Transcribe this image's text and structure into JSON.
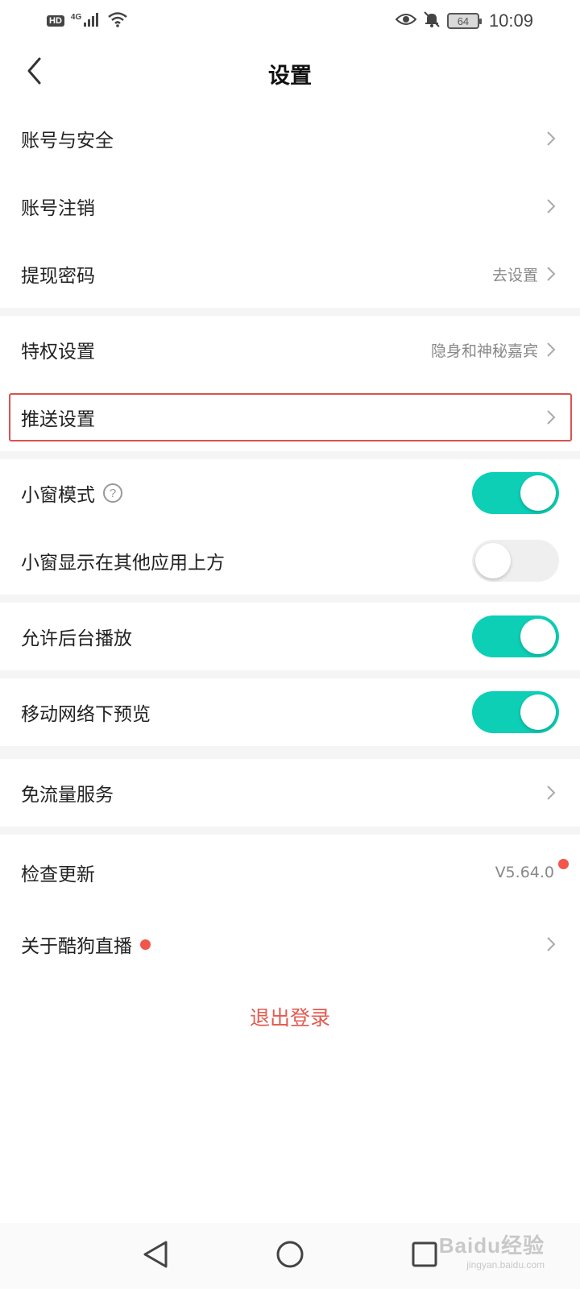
{
  "status_bar": {
    "hd": "HD",
    "network": "4G",
    "battery": "64",
    "time": "10:09",
    "icons": [
      "signal-icon",
      "wifi-icon",
      "eye-icon",
      "bell-off-icon"
    ]
  },
  "header": {
    "title": "设置",
    "back_icon": "chevron-left-icon"
  },
  "settings": {
    "account_security": {
      "label": "账号与安全"
    },
    "account_cancel": {
      "label": "账号注销"
    },
    "withdraw_password": {
      "label": "提现密码",
      "value": "去设置"
    },
    "privilege": {
      "label": "特权设置",
      "value": "隐身和神秘嘉宾"
    },
    "push": {
      "label": "推送设置"
    },
    "mini_window": {
      "label": "小窗模式",
      "help": "?",
      "on": true
    },
    "mini_window_overlay": {
      "label": "小窗显示在其他应用上方",
      "on": false
    },
    "background_play": {
      "label": "允许后台播放",
      "on": true
    },
    "mobile_preview": {
      "label": "移动网络下预览",
      "on": true
    },
    "free_data": {
      "label": "免流量服务"
    },
    "check_update": {
      "label": "检查更新",
      "value": "V5.64.0"
    },
    "about": {
      "label": "关于酷狗直播"
    }
  },
  "logout": {
    "label": "退出登录"
  },
  "nav_bar": {
    "icons": [
      "back-triangle-icon",
      "home-circle-icon",
      "recents-square-icon"
    ]
  },
  "watermark": {
    "main": "Baidu经验",
    "sub": "jingyan.baidu.com"
  },
  "colors": {
    "toggle_on": "#0ccfb6",
    "toggle_off": "#efefef",
    "logout_text": "#e35a4f",
    "red_dot": "#f0564b",
    "highlight_border": "#d9534f"
  }
}
